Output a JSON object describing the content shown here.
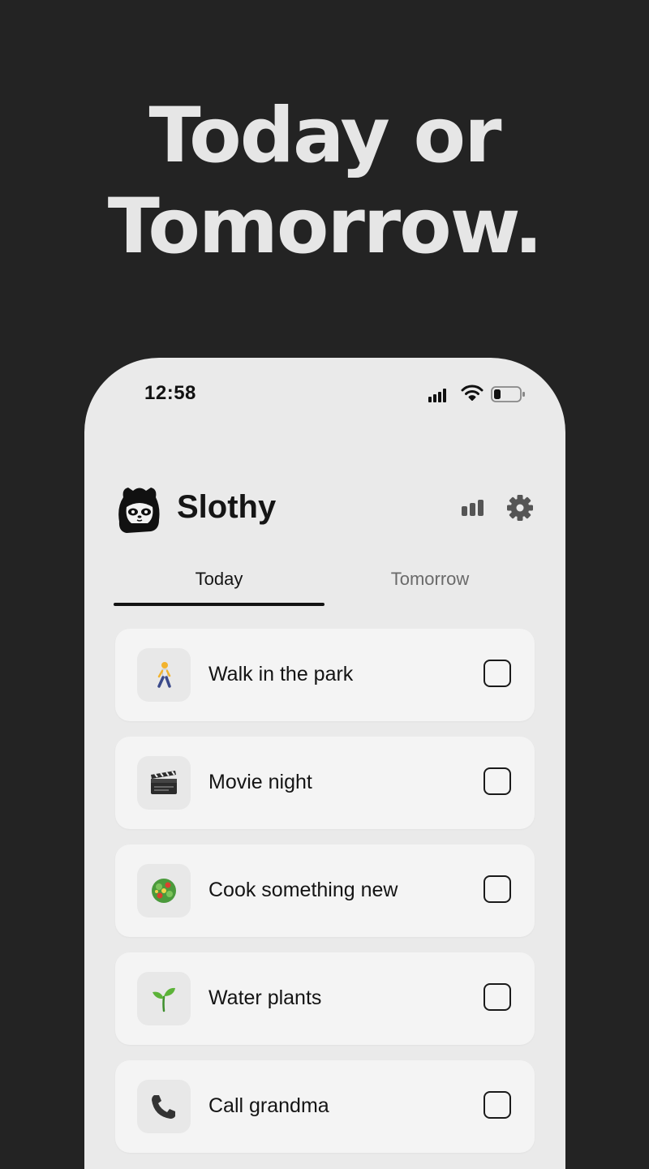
{
  "headline": {
    "line1": "Today or",
    "line2": "Tomorrow."
  },
  "status_bar": {
    "time": "12:58",
    "icons": [
      "signal-icon",
      "wifi-icon",
      "battery-icon"
    ]
  },
  "app": {
    "title": "Slothy",
    "logo": "sloth-logo-icon",
    "header_icons": [
      "stats-icon",
      "gear-icon"
    ]
  },
  "tabs": [
    {
      "label": "Today",
      "active": true
    },
    {
      "label": "Tomorrow",
      "active": false
    }
  ],
  "tasks": [
    {
      "label": "Walk in the park",
      "icon": "walking-person-icon",
      "checked": false
    },
    {
      "label": "Movie night",
      "icon": "clapperboard-icon",
      "checked": false
    },
    {
      "label": "Cook something new",
      "icon": "salad-icon",
      "checked": false
    },
    {
      "label": "Water plants",
      "icon": "seedling-icon",
      "checked": false
    },
    {
      "label": "Call grandma",
      "icon": "phone-icon",
      "checked": false
    }
  ],
  "colors": {
    "background": "#232323",
    "phone": "#eaeaea",
    "card": "#f4f4f4",
    "text": "#141414",
    "inactive_tab": "#6a6a6a"
  }
}
